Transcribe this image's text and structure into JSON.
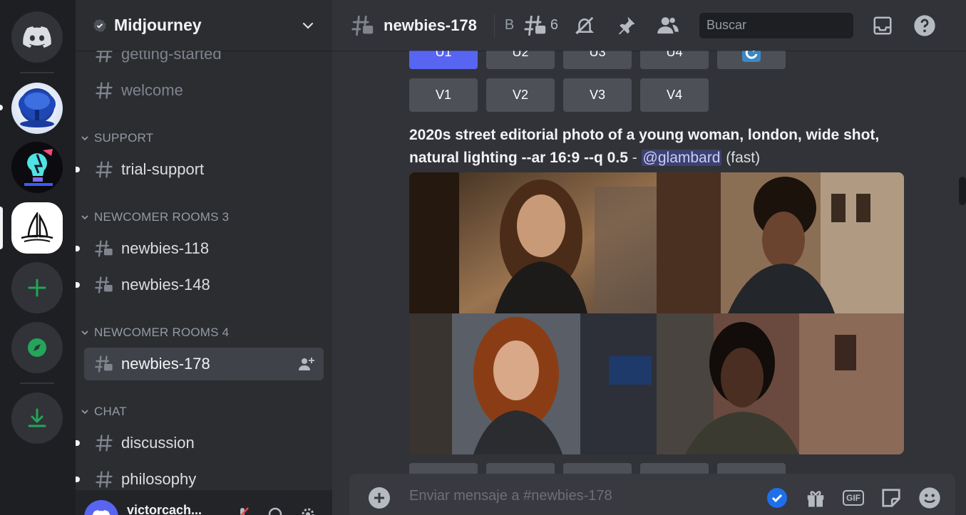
{
  "server": {
    "name": "Midjourney"
  },
  "channels": [
    {
      "label": "getting-started"
    },
    {
      "label": "welcome"
    }
  ],
  "categories": {
    "support": "SUPPORT",
    "rooms3": "NEWCOMER ROOMS 3",
    "rooms4": "NEWCOMER ROOMS 4",
    "chat": "CHAT"
  },
  "support_channels": [
    {
      "label": "trial-support"
    }
  ],
  "rooms3_channels": [
    {
      "label": "newbies-118"
    },
    {
      "label": "newbies-148"
    }
  ],
  "rooms4_channels": [
    {
      "label": "newbies-178"
    }
  ],
  "chat_channels": [
    {
      "label": "discussion"
    },
    {
      "label": "philosophy"
    }
  ],
  "user": {
    "name": "victorcach..."
  },
  "topbar": {
    "channel": "newbies-178",
    "topic": "B",
    "thread_count": "6",
    "search_placeholder": "Buscar"
  },
  "buttons_top": [
    "U1",
    "U2",
    "U3",
    "U4"
  ],
  "buttons_v": [
    "V1",
    "V2",
    "V3",
    "V4"
  ],
  "message": {
    "prompt": "2020s street editorial photo of a young woman, london, wide shot, natural lighting --ar 16:9 --q 0.5",
    "separator": " - ",
    "mention": "@glambard",
    "speed": " (fast)"
  },
  "composer": {
    "placeholder": "Enviar mensaje a #newbies-178",
    "gif": "GIF"
  },
  "colors": {
    "accent": "#5865f2",
    "online": "#23a55a",
    "background": "#313338"
  }
}
